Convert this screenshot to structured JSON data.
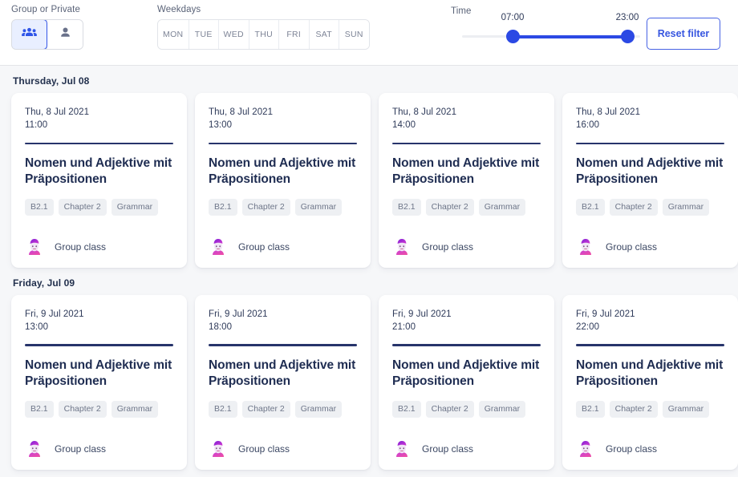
{
  "filters": {
    "type_label": "Group or Private",
    "type_options": [
      {
        "name": "group",
        "icon": "group-people-icon",
        "selected": true
      },
      {
        "name": "private",
        "icon": "single-person-icon",
        "selected": false
      }
    ],
    "weekdays_label": "Weekdays",
    "weekdays": [
      "MON",
      "TUE",
      "WED",
      "THU",
      "FRI",
      "SAT",
      "SUN"
    ],
    "time_label": "Time",
    "time_min": "07:00",
    "time_max": "23:00",
    "reset_label": "Reset filter",
    "accent_color": "#2b49e4",
    "selected_bg": "#e9efff"
  },
  "groups": [
    {
      "heading": "Thursday, Jul 08",
      "cards": [
        {
          "date": "Thu, 8 Jul 2021",
          "time": "11:00",
          "title": "Nomen und Adjektive mit Präpositionen",
          "tags": [
            "B2.1",
            "Chapter 2",
            "Grammar"
          ],
          "class_type": "Group class",
          "avatar": "teacher-avatar"
        },
        {
          "date": "Thu, 8 Jul 2021",
          "time": "13:00",
          "title": "Nomen und Adjektive mit Präpositionen",
          "tags": [
            "B2.1",
            "Chapter 2",
            "Grammar"
          ],
          "class_type": "Group class",
          "avatar": "teacher-avatar"
        },
        {
          "date": "Thu, 8 Jul 2021",
          "time": "14:00",
          "title": "Nomen und Adjektive mit Präpositionen",
          "tags": [
            "B2.1",
            "Chapter 2",
            "Grammar"
          ],
          "class_type": "Group class",
          "avatar": "teacher-avatar"
        },
        {
          "date": "Thu, 8 Jul 2021",
          "time": "16:00",
          "title": "Nomen und Adjektive mit Präpositionen",
          "tags": [
            "B2.1",
            "Chapter 2",
            "Grammar"
          ],
          "class_type": "Group class",
          "avatar": "teacher-avatar"
        }
      ]
    },
    {
      "heading": "Friday, Jul 09",
      "cards": [
        {
          "date": "Fri, 9 Jul 2021",
          "time": "13:00",
          "title": "Nomen und Adjektive mit Präpositionen",
          "tags": [
            "B2.1",
            "Chapter 2",
            "Grammar"
          ],
          "class_type": "Group class",
          "avatar": "teacher-avatar"
        },
        {
          "date": "Fri, 9 Jul 2021",
          "time": "18:00",
          "title": "Nomen und Adjektive mit Präpositionen",
          "tags": [
            "B2.1",
            "Chapter 2",
            "Grammar"
          ],
          "class_type": "Group class",
          "avatar": "teacher-avatar"
        },
        {
          "date": "Fri, 9 Jul 2021",
          "time": "21:00",
          "title": "Nomen und Adjektive mit Präpositionen",
          "tags": [
            "B2.1",
            "Chapter 2",
            "Grammar"
          ],
          "class_type": "Group class",
          "avatar": "teacher-avatar"
        },
        {
          "date": "Fri, 9 Jul 2021",
          "time": "22:00",
          "title": "Nomen und Adjektive mit Präpositionen",
          "tags": [
            "B2.1",
            "Chapter 2",
            "Grammar"
          ],
          "class_type": "Group class",
          "avatar": "teacher-avatar"
        }
      ]
    }
  ]
}
